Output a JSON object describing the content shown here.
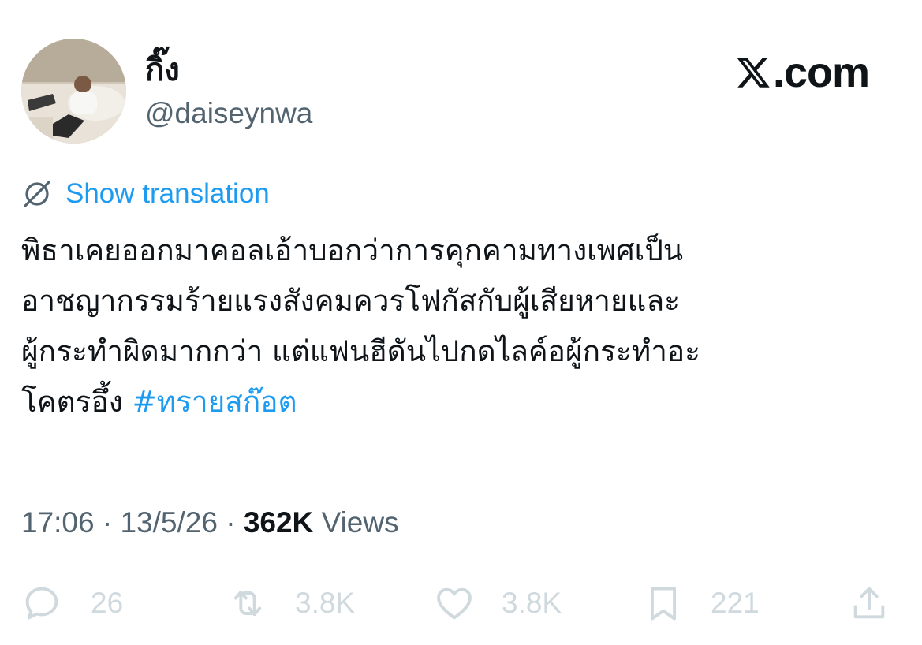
{
  "user": {
    "display_name": "กิ๊ง",
    "handle": "@daiseynwa",
    "avatar_icon": "user-avatar-photo"
  },
  "brand": {
    "logo_text": ".com",
    "logo_icon": "x-logo-icon"
  },
  "translation": {
    "label": "Show translation",
    "icon": "globe-icon"
  },
  "tweet": {
    "lines": [
      "พิธาเคยออกมาคอลเอ้าบอกว่าการคุกคามทางเพศเป็น",
      "อาชญากรรมร้ายแรงสังคมควรโฟกัสกับผู้เสียหายและ",
      "ผู้กระทำผิดมากกว่า แต่แฟนฮีดันไปกดไลค์อผู้กระทำอะ",
      "โคตรอึ้ง "
    ],
    "hashtag": "#ทรายสก๊อต"
  },
  "meta": {
    "time": "17:06",
    "separator": "·",
    "date": "13/5/26",
    "views_count": "362K",
    "views_label": "Views"
  },
  "actions": {
    "reply": {
      "count": "26",
      "icon": "reply-icon"
    },
    "retweet": {
      "count": "3.8K",
      "icon": "retweet-icon"
    },
    "like": {
      "count": "3.8K",
      "icon": "heart-icon"
    },
    "bookmark": {
      "count": "221",
      "icon": "bookmark-icon"
    },
    "share": {
      "icon": "share-icon"
    }
  },
  "colors": {
    "accent": "#1d9bf0",
    "text": "#0f1419",
    "muted": "#536471",
    "faint": "#cfd9de"
  }
}
